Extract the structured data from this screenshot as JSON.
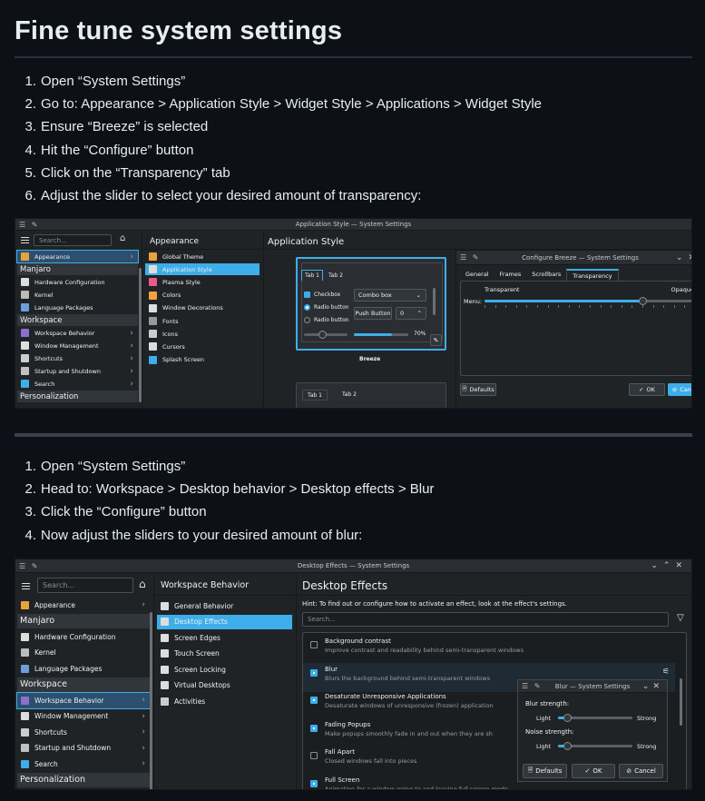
{
  "heading": "Fine tune system settings",
  "steps1": [
    {
      "n": "1.",
      "text": "Open “System Settings”"
    },
    {
      "n": "2.",
      "text": "Go to: Appearance > Application Style > Widget Style > Applications > Widget Style"
    },
    {
      "n": "3.",
      "text": "Ensure “Breeze” is selected"
    },
    {
      "n": "4.",
      "text": "Hit the “Configure” button"
    },
    {
      "n": "5.",
      "text": "Click on the “Transparency” tab"
    },
    {
      "n": "6.",
      "text": "Adjust the slider to select your desired amount of transparency:"
    }
  ],
  "steps2": [
    {
      "n": "1.",
      "text": "Open “System Settings”"
    },
    {
      "n": "2.",
      "text": "Head to: Workspace > Desktop behavior > Desktop effects > Blur"
    },
    {
      "n": "3.",
      "text": "Click the “Configure” button"
    },
    {
      "n": "4.",
      "text": "Now adjust the sliders to your desired amount of blur:"
    }
  ],
  "shot1": {
    "window_title": "Application Style — System Settings",
    "search_placeholder": "Search...",
    "col2_header": "Appearance",
    "main_header": "Application Style",
    "sidebar": [
      {
        "type": "item",
        "label": "Appearance",
        "selected": true,
        "color": "#e8a33b",
        "chev": true
      },
      {
        "type": "cat",
        "label": "Manjaro"
      },
      {
        "type": "item",
        "label": "Hardware Configuration",
        "color": "#dddddd"
      },
      {
        "type": "item",
        "label": "Kernel",
        "color": "#bbbbbb"
      },
      {
        "type": "item",
        "label": "Language Packages",
        "color": "#6aa0d8"
      },
      {
        "type": "cat",
        "label": "Workspace"
      },
      {
        "type": "item",
        "label": "Workspace Behavior",
        "color": "#8b6fd1",
        "chev": true
      },
      {
        "type": "item",
        "label": "Window Management",
        "color": "#dddddd",
        "chev": true
      },
      {
        "type": "item",
        "label": "Shortcuts",
        "color": "#cccccc",
        "chev": true
      },
      {
        "type": "item",
        "label": "Startup and Shutdown",
        "color": "#c0c0c0",
        "chev": true
      },
      {
        "type": "item",
        "label": "Search",
        "color": "#3daee9",
        "chev": true
      },
      {
        "type": "cat",
        "label": "Personalization"
      }
    ],
    "col2": [
      {
        "label": "Global Theme",
        "color": "#e8a33b"
      },
      {
        "label": "Application Style",
        "selected": true,
        "color": "#dddddd"
      },
      {
        "label": "Plasma Style",
        "color": "#e85a8a"
      },
      {
        "label": "Colors",
        "color": "#f2a13b"
      },
      {
        "label": "Window Decorations",
        "color": "#dddddd"
      },
      {
        "label": "Fonts",
        "color": "#999999"
      },
      {
        "label": "Icons",
        "color": "#cccccc"
      },
      {
        "label": "Cursors",
        "color": "#dddddd"
      },
      {
        "label": "Splash Screen",
        "color": "#3daee9"
      }
    ],
    "preview": {
      "tab1": "Tab 1",
      "tab2": "Tab 2",
      "checkbox": "Checkbox",
      "radio1": "Radio button",
      "radio2": "Radio button",
      "combo": "Combo box",
      "push": "Push Button",
      "spin": "0",
      "pct": "70%",
      "name": "Breeze",
      "progress": 0.7
    },
    "dialog": {
      "title": "Configure Breeze — System Settings",
      "tabs": [
        "General",
        "Frames",
        "Scrollbars",
        "Transparency"
      ],
      "active_tab": 3,
      "min_label": "Transparent",
      "max_label": "Opaque",
      "menu_label": "Menu:",
      "slider_value": 0.75,
      "defaults": "Defaults",
      "ok": "OK",
      "cancel": "Cancel"
    }
  },
  "shot2": {
    "window_title": "Desktop Effects — System Settings",
    "search_placeholder": "Search...",
    "col2_header": "Workspace Behavior",
    "main_header": "Desktop Effects",
    "hint": "Hint: To find out or configure how to activate an effect, look at the effect's settings.",
    "effects_search": "Search...",
    "sidebar": [
      {
        "type": "item",
        "label": "Appearance",
        "color": "#e8a33b",
        "chev": true
      },
      {
        "type": "cat",
        "label": "Manjaro"
      },
      {
        "type": "item",
        "label": "Hardware Configuration",
        "color": "#dddddd"
      },
      {
        "type": "item",
        "label": "Kernel",
        "color": "#bbbbbb"
      },
      {
        "type": "item",
        "label": "Language Packages",
        "color": "#6aa0d8"
      },
      {
        "type": "cat",
        "label": "Workspace"
      },
      {
        "type": "item",
        "label": "Workspace Behavior",
        "selected": true,
        "color": "#8b6fd1",
        "chev": true
      },
      {
        "type": "item",
        "label": "Window Management",
        "color": "#dddddd",
        "chev": true
      },
      {
        "type": "item",
        "label": "Shortcuts",
        "color": "#cccccc",
        "chev": true
      },
      {
        "type": "item",
        "label": "Startup and Shutdown",
        "color": "#c0c0c0",
        "chev": true
      },
      {
        "type": "item",
        "label": "Search",
        "color": "#3daee9",
        "chev": true
      },
      {
        "type": "cat",
        "label": "Personalization"
      }
    ],
    "col2": [
      {
        "label": "General Behavior",
        "color": "#dddddd"
      },
      {
        "label": "Desktop Effects",
        "selected": true,
        "color": "#dddddd"
      },
      {
        "label": "Screen Edges",
        "color": "#dddddd"
      },
      {
        "label": "Touch Screen",
        "color": "#dddddd"
      },
      {
        "label": "Screen Locking",
        "color": "#dddddd"
      },
      {
        "label": "Virtual Desktops",
        "color": "#dddddd"
      },
      {
        "label": "Activities",
        "color": "#cccccc"
      }
    ],
    "effects": [
      {
        "title": "Background contrast",
        "desc": "Improve contrast and readability behind semi-transparent windows",
        "on": false
      },
      {
        "title": "Blur",
        "desc": "Blurs the background behind semi-transparent windows",
        "on": true
      },
      {
        "title": "Desaturate Unresponsive Applications",
        "desc": "Desaturate windows of unresponsive (frozen) application",
        "on": true
      },
      {
        "title": "Fading Popups",
        "desc": "Make popups smoothly fade in and out when they are sh",
        "on": true
      },
      {
        "title": "Fall Apart",
        "desc": "Closed windows fall into pieces",
        "on": false
      },
      {
        "title": "Full Screen",
        "desc": "Animation for a window going to and leaving full screen mode",
        "on": true
      }
    ],
    "blur_dialog": {
      "title": "Blur — System Settings",
      "strength_label": "Blur strength:",
      "noise_label": "Noise strength:",
      "light": "Light",
      "strong": "Strong",
      "blur_value": 0.12,
      "noise_value": 0.12,
      "defaults": "Defaults",
      "ok": "OK",
      "cancel": "Cancel"
    }
  }
}
